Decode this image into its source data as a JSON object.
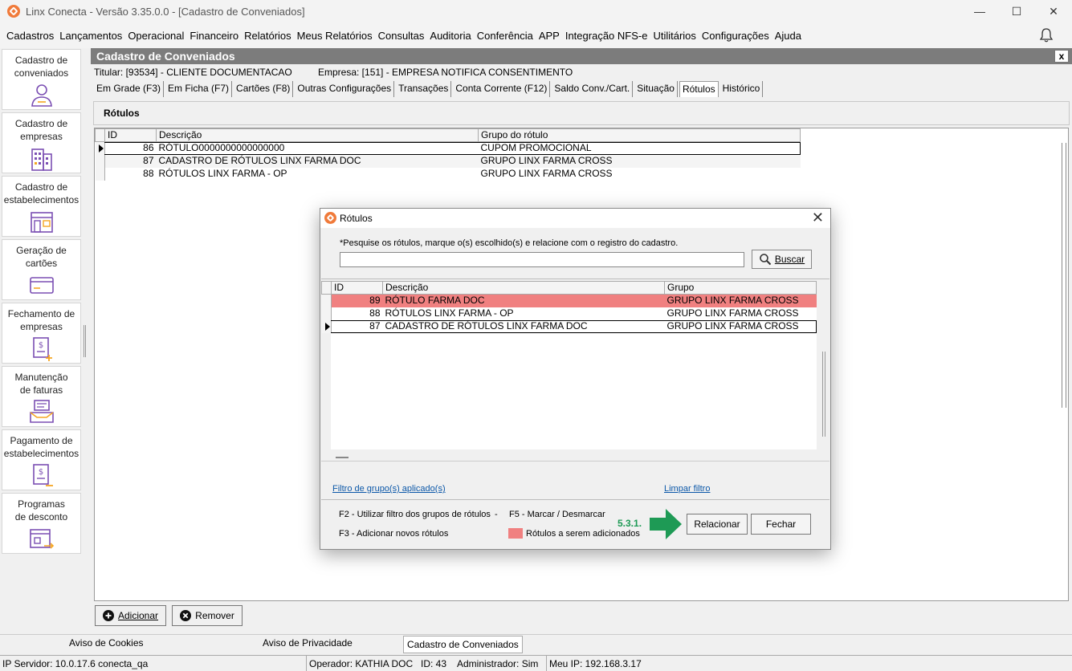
{
  "window": {
    "title": "Linx Conecta - Versão 3.35.0.0 - [Cadastro de Conveniados]",
    "minimize": "—",
    "maximize": "☐",
    "close": "✕"
  },
  "menu": [
    "Cadastros",
    "Lançamentos",
    "Operacional",
    "Financeiro",
    "Relatórios",
    "Meus Relatórios",
    "Consultas",
    "Auditoria",
    "Conferência",
    "APP",
    "Integração NFS-e",
    "Utilitários",
    "Configurações",
    "Ajuda"
  ],
  "sidebar": {
    "items": [
      {
        "line1": "Cadastro de",
        "line2": "conveniados",
        "icon": "user-icon"
      },
      {
        "line1": "Cadastro de",
        "line2": "empresas",
        "icon": "building-icon"
      },
      {
        "line1": "Cadastro de",
        "line2": "estabelecimentos",
        "icon": "store-icon"
      },
      {
        "line1": "Geração de",
        "line2": "cartões",
        "icon": "card-icon"
      },
      {
        "line1": "Fechamento de",
        "line2": "empresas",
        "icon": "invoice-icon"
      },
      {
        "line1": "Manutenção",
        "line2": "de faturas",
        "icon": "tray-icon"
      },
      {
        "line1": "Pagamento de",
        "line2": "estabelecimentos",
        "icon": "payment-icon"
      },
      {
        "line1": "Programas",
        "line2": "de desconto",
        "icon": "discount-icon"
      }
    ]
  },
  "panel": {
    "title": "Cadastro de Conveniados",
    "close": "x",
    "titular": "Titular: [93534] - CLIENTE DOCUMENTACAO",
    "empresa": "Empresa: [151] - EMPRESA NOTIFICA CONSENTIMENTO",
    "tabs": [
      "Em Grade (F3)",
      "Em Ficha (F7)",
      "Cartões (F8)",
      "Outras Configurações",
      "Transações",
      "Conta Corrente (F12)",
      "Saldo Conv./Cart.",
      "Situação",
      "Rótulos",
      "Histórico"
    ],
    "active_tab": "Rótulos",
    "section_title": "Rótulos",
    "grid": {
      "headers": [
        "ID",
        "Descrição",
        "Grupo do rótulo"
      ],
      "rows": [
        {
          "id": "86",
          "desc": "RÓTULO0000000000000000",
          "grupo": "CUPOM PROMOCIONAL"
        },
        {
          "id": "87",
          "desc": "CADASTRO DE RÓTULOS LINX FARMA DOC",
          "grupo": "GRUPO LINX  FARMA CROSS"
        },
        {
          "id": "88",
          "desc": "RÓTULOS LINX FARMA - OP",
          "grupo": "GRUPO LINX  FARMA CROSS"
        }
      ]
    },
    "add_button": "Adicionar",
    "remove_button": "Remover"
  },
  "doc_tabs": [
    "Aviso de Cookies",
    "Aviso de Privacidade",
    "Cadastro de Conveniados"
  ],
  "status": {
    "server": "IP Servidor: 10.0.17.6 conecta_qa",
    "operator": "Operador: KATHIA DOC",
    "id": "ID: 43",
    "admin": "Administrador: Sim",
    "ip": "Meu IP: 192.168.3.17"
  },
  "dialog": {
    "title": "Rótulos",
    "close": "✕",
    "search_label": "*Pesquise os rótulos, marque o(s) escolhido(s) e relacione com o registro do cadastro.",
    "search_value": "",
    "search_button": "Buscar",
    "grid": {
      "headers": [
        "ID",
        "Descrição",
        "Grupo"
      ],
      "rows": [
        {
          "id": "89",
          "desc": "RÓTULO FARMA DOC",
          "grupo": "GRUPO LINX  FARMA CROSS",
          "highlight": true
        },
        {
          "id": "88",
          "desc": "RÓTULOS LINX FARMA - OP",
          "grupo": "GRUPO LINX  FARMA CROSS"
        },
        {
          "id": "87",
          "desc": "CADASTRO DE RÓTULOS LINX FARMA DOC",
          "grupo": "GRUPO LINX  FARMA CROSS"
        }
      ]
    },
    "filter_link": "Filtro de grupo(s) aplicado(s)",
    "clear_link": "Limpar filtro",
    "hint_f2": "F2 - Utilizar filtro dos grupos de rótulos",
    "hint_sep": "-",
    "hint_f5": "F5 - Marcar / Desmarcar",
    "hint_f3": "F3 - Adicionar novos rótulos",
    "legend": "Rótulos a serem adicionados",
    "step": "5.3.1.",
    "relate_button": "Relacionar",
    "close_button": "Fechar"
  },
  "colors": {
    "highlight": "#f08080",
    "panel_header": "#7c7c7c",
    "brand_orange": "#f07a3a",
    "icon_purple": "#7b4fb3",
    "icon_orange": "#f5a623",
    "step_green": "#1e9a55",
    "link_blue": "#0b57a8"
  }
}
